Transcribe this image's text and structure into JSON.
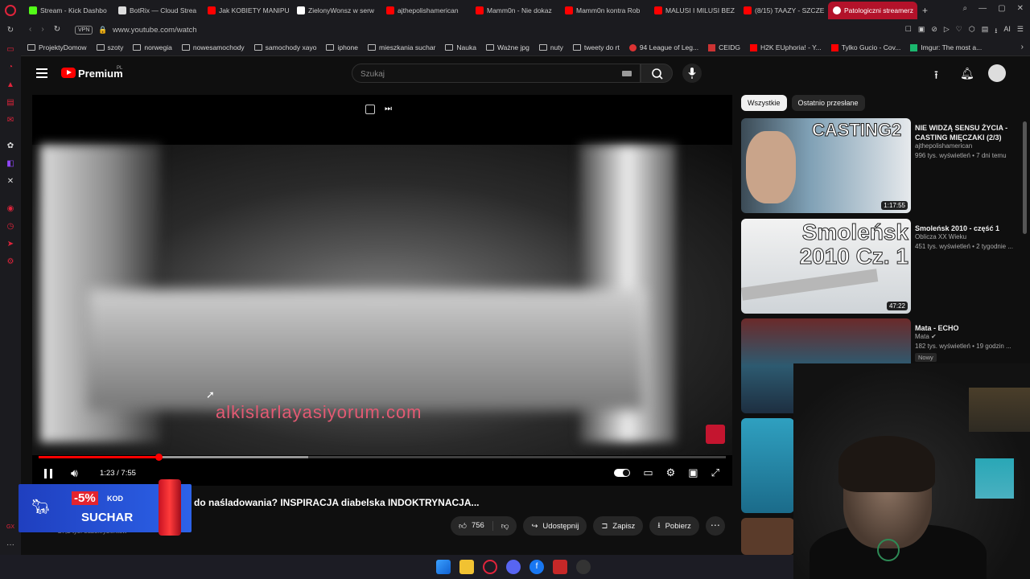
{
  "browser": {
    "tabs": [
      {
        "label": "Stream - Kick Dashbo",
        "color": "#53fc18"
      },
      {
        "label": "BotRix — Cloud Strea",
        "color": "#ffffff"
      },
      {
        "label": "Jak KOBIETY MANIPU",
        "color": "#ff0000"
      },
      {
        "label": "ZielonyWonsz w serw",
        "color": "#ffffff"
      },
      {
        "label": "ajthepolishamerican",
        "color": "#ff0000"
      },
      {
        "label": "Mamm0n - Nie dokaz",
        "color": "#ff0000"
      },
      {
        "label": "Mamm0n kontra Rob",
        "color": "#ff0000"
      },
      {
        "label": "MALUSI I MILUSI BEZ",
        "color": "#ff0000"
      },
      {
        "label": "(8/15) TAAZY - SZCZE",
        "color": "#ff0000"
      },
      {
        "label": "Patologiczni streamerz",
        "color": "#ff0000",
        "active": true
      }
    ],
    "vpn_label": "VPN",
    "url": "www.youtube.com/watch",
    "ai_label": "AI",
    "bookmarks": [
      "ProjektyDomow",
      "szoty",
      "norwegia",
      "nowesamochody",
      "samochody xayo",
      "iphone",
      "mieszkania suchar",
      "Nauka",
      "Ważne jpg",
      "nuty",
      "tweety do rt",
      "94 League of Leg...",
      "CEIDG",
      "H2K EUphoria! - Y...",
      "Tylko Gucio - Cov...",
      "Imgur: The most a..."
    ]
  },
  "youtube": {
    "brand": "Premium",
    "brand_suffix": "PL",
    "search_placeholder": "Szukaj",
    "player": {
      "watermark": "alkislarlayasiyorum.com",
      "current_time": "1:23",
      "duration": "7:55",
      "time_display": "1:23 / 7:55",
      "played_fraction": 0.175,
      "buffered_fraction": 0.392
    },
    "video_title": "do naśladowania? INSPIRACJA diabelska INDOKTRYNACJA...",
    "subscribers": "27,2 tys. subskrybentów",
    "actions": {
      "likes": "756",
      "share": "Udostępnij",
      "save": "Zapisz",
      "download": "Pobierz"
    },
    "ad": {
      "discount": "-5%",
      "kod": "KOD",
      "code": "SUCHAR"
    },
    "chips": [
      "Wszystkie",
      "Ostatnio przesłane"
    ],
    "recommendations": [
      {
        "title": "NIE WIDZĄ SENSU ŻYCIA - CASTING MIĘCZAKI (2/3)",
        "channel": "ajthepolishamerican",
        "meta": "996 tys. wyświetleń • 7 dni temu",
        "duration": "1:17:55",
        "thumb_text": "CASTING2"
      },
      {
        "title": "Smoleńsk 2010 - część 1",
        "channel": "Oblicza XX Wieku",
        "meta": "451 tys. wyświetleń • 2 tygodnie ...",
        "duration": "47:22",
        "thumb_text": "Smoleńsk 2010 Cz. 1"
      },
      {
        "title": "Mata - ECHO",
        "channel": "Mata",
        "meta": "182 tys. wyświetleń • 19 godzin ...",
        "badge": "Nowy"
      }
    ]
  }
}
